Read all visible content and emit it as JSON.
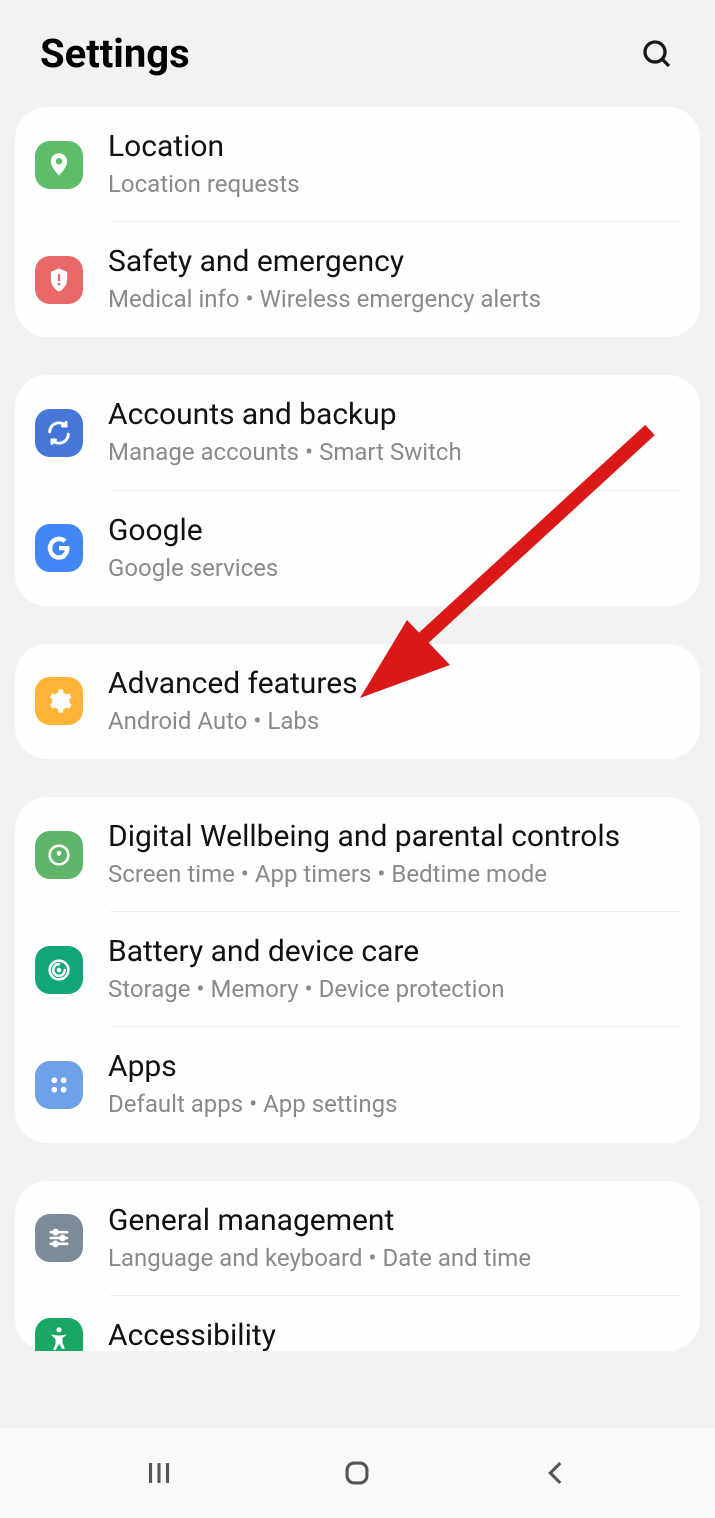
{
  "header": {
    "title": "Settings"
  },
  "groups": [
    {
      "items": [
        {
          "icon": "location",
          "title": "Location",
          "subtitle": "Location requests"
        },
        {
          "icon": "safety",
          "title": "Safety and emergency",
          "subtitle": "Medical info  •  Wireless emergency alerts"
        }
      ]
    },
    {
      "items": [
        {
          "icon": "accounts",
          "title": "Accounts and backup",
          "subtitle": "Manage accounts  •  Smart Switch"
        },
        {
          "icon": "google",
          "title": "Google",
          "subtitle": "Google services"
        }
      ]
    },
    {
      "items": [
        {
          "icon": "advanced",
          "title": "Advanced features",
          "subtitle": "Android Auto  •  Labs"
        }
      ]
    },
    {
      "items": [
        {
          "icon": "wellbeing",
          "title": "Digital Wellbeing and parental controls",
          "subtitle": "Screen time  •  App timers  •  Bedtime mode"
        },
        {
          "icon": "battery",
          "title": "Battery and device care",
          "subtitle": "Storage  •  Memory  •  Device protection"
        },
        {
          "icon": "apps",
          "title": "Apps",
          "subtitle": "Default apps  •  App settings"
        }
      ]
    },
    {
      "items": [
        {
          "icon": "general",
          "title": "General management",
          "subtitle": "Language and keyboard  •  Date and time"
        },
        {
          "icon": "accessibility",
          "title": "Accessibility",
          "subtitle": "",
          "partial": true
        }
      ]
    }
  ],
  "annotation": {
    "target": "Advanced features",
    "arrow_color": "#da1818"
  }
}
